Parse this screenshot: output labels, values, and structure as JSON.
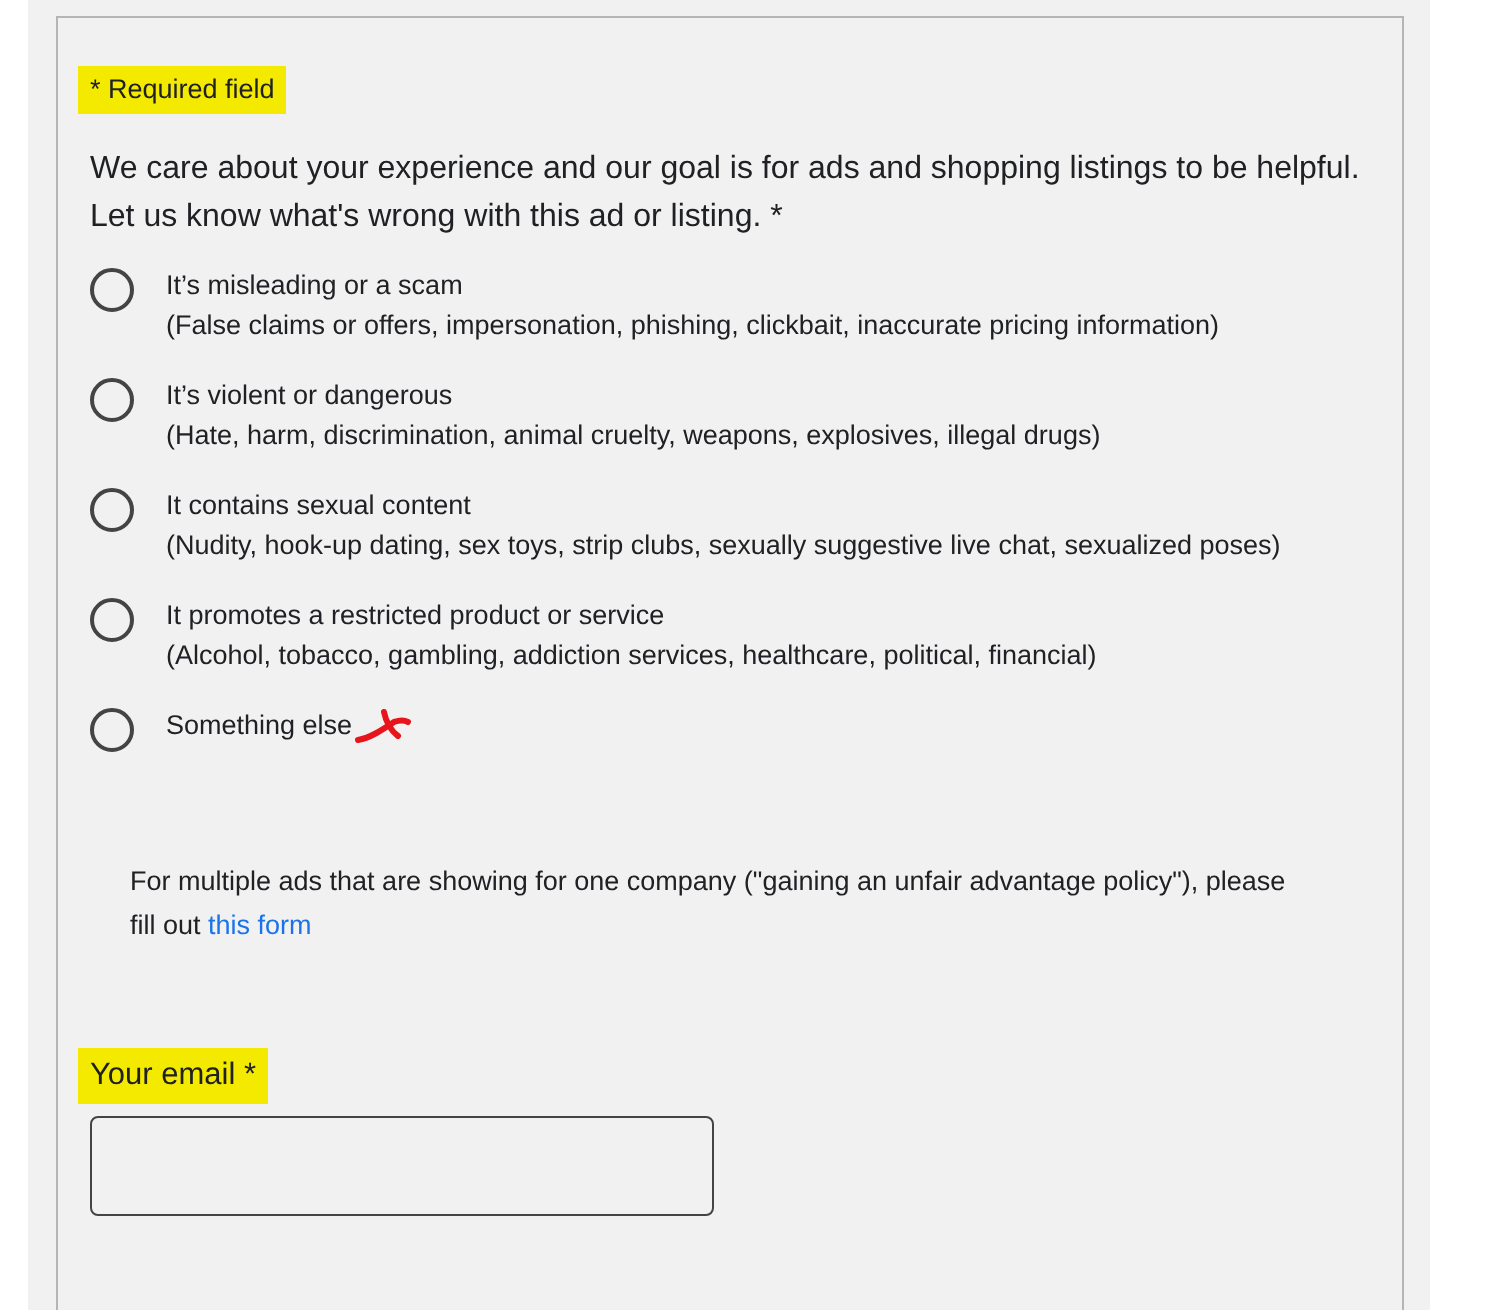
{
  "required_note": {
    "text": "* Required field",
    "highlighted": true
  },
  "question": "We care about your experience and our goal is for ads and shopping listings to be helpful. Let us know what's wrong with this ad or listing. *",
  "options": [
    {
      "label": "It’s misleading or a scam",
      "detail": "(False claims or offers, impersonation, phishing, clickbait, inaccurate pricing information)",
      "selected": false,
      "marked": false
    },
    {
      "label": "It’s violent or dangerous",
      "detail": "(Hate, harm, discrimination, animal cruelty, weapons, explosives, illegal drugs)",
      "selected": false,
      "marked": false
    },
    {
      "label": "It contains sexual content",
      "detail": "(Nudity, hook-up dating, sex toys, strip clubs, sexually suggestive live chat, sexualized poses)",
      "selected": false,
      "marked": false
    },
    {
      "label": "It promotes a restricted product or service",
      "detail": "(Alcohol, tobacco, gambling, addiction services, healthcare, political, financial)",
      "selected": false,
      "marked": false
    },
    {
      "label": "Something else",
      "selected": false,
      "marked": true
    }
  ],
  "note": {
    "text": "For multiple ads that are showing for one company (\"gaining an unfair advantage policy\"), please fill out",
    "link": "this form"
  },
  "email": {
    "label": "Your email *",
    "highlighted": true
  }
}
